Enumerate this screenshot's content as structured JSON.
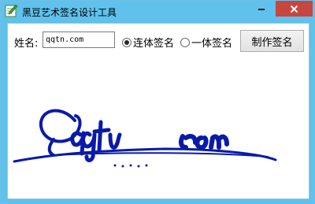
{
  "window": {
    "title": "黑豆艺术签名设计工具",
    "titlebar_color": "#5fc1ec",
    "close_button_color": "#c7463f"
  },
  "form": {
    "name_label": "姓名:",
    "name_input_value": "qqtn.com",
    "radio_options": [
      {
        "label": "连体签名",
        "checked": true
      },
      {
        "label": "一体签名",
        "checked": false
      }
    ],
    "make_button_label": "制作签名"
  },
  "signature": {
    "text": "qqtn.com",
    "ink_color": "#0a1aa8"
  },
  "icons": {
    "app": "pencil-note-icon",
    "minimize": "minimize-icon",
    "maximize": "maximize-icon",
    "close": "close-icon"
  }
}
